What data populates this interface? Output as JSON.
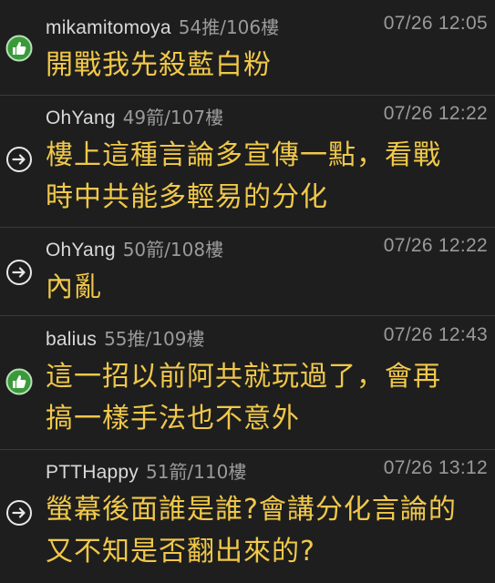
{
  "comments": [
    {
      "type": "push",
      "author": "mikamitomoya",
      "floor": "54推/106樓",
      "time": "07/26 12:05",
      "lines": [
        "開戰我先殺藍白粉"
      ]
    },
    {
      "type": "arrow",
      "author": "OhYang",
      "floor": "49箭/107樓",
      "time": "07/26 12:22",
      "lines": [
        "樓上這種言論多宣傳一點，看戰",
        "時中共能多輕易的分化"
      ]
    },
    {
      "type": "arrow",
      "author": "OhYang",
      "floor": "50箭/108樓",
      "time": "07/26 12:22",
      "lines": [
        "內亂"
      ]
    },
    {
      "type": "push",
      "author": "balius",
      "floor": "55推/109樓",
      "time": "07/26 12:43",
      "lines": [
        "這一招以前阿共就玩過了，會再",
        "搞一樣手法也不意外"
      ]
    },
    {
      "type": "arrow",
      "author": "PTTHappy",
      "floor": "51箭/110樓",
      "time": "07/26 13:12",
      "lines": [
        "螢幕後面誰是誰?會講分化言論的",
        "又不知是否翻出來的?"
      ]
    }
  ],
  "icons": {
    "push": "thumbs-up-icon",
    "arrow": "arrow-right-icon"
  },
  "colors": {
    "background": "#1e1e1e",
    "content": "#f0c84a",
    "author": "#d9d9d9",
    "meta": "#9a9a9a",
    "push_icon": "#3a9a3a"
  }
}
